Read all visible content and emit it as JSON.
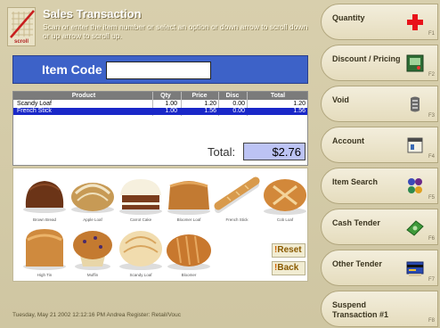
{
  "header": {
    "logo_label": "scroll",
    "title": "Sales Transaction",
    "instruction": "Scan or enter the item number or select an option or down arrow to scroll down or up arrow to scroll up."
  },
  "item_code": {
    "label": "Item Code",
    "value": ""
  },
  "table": {
    "columns": [
      "Product",
      "Qty",
      "Price",
      "Disc",
      "Total"
    ],
    "rows": [
      {
        "product": "Scandy Loaf",
        "qty": "1.00",
        "price": "1.20",
        "disc": "0.00",
        "total": "1.20"
      },
      {
        "product": "French Stick",
        "qty": "1.00",
        "price": "1.56",
        "disc": "0.00",
        "total": "1.56"
      }
    ]
  },
  "total": {
    "label": "Total:",
    "value": "$2.76"
  },
  "products": [
    {
      "name": "Brown Bread"
    },
    {
      "name": "Apple Loaf"
    },
    {
      "name": "Carrot Cake"
    },
    {
      "name": "Bloomer Loaf"
    },
    {
      "name": "French Stick"
    },
    {
      "name": "Cob Loaf"
    },
    {
      "name": "High Tin"
    },
    {
      "name": "Muffin"
    },
    {
      "name": "Scandy Loaf"
    },
    {
      "name": "Bloomer"
    }
  ],
  "grid_buttons": {
    "reset": "Reset",
    "back": "Back"
  },
  "status_bar": {
    "text": "Tuesday, May 21 2002   12:12:16 PM   Andrea   Register: Retail/Vouc"
  },
  "side_buttons": [
    {
      "label": "Quantity",
      "fkey": "F1",
      "icon": "red-plus-icon"
    },
    {
      "label": "Discount / Pricing",
      "fkey": "F2",
      "icon": "discount-icon"
    },
    {
      "label": "Void",
      "fkey": "F3",
      "icon": "void-icon"
    },
    {
      "label": "Account",
      "fkey": "F4",
      "icon": "account-icon"
    },
    {
      "label": "Item Search",
      "fkey": "F5",
      "icon": "search-icon"
    },
    {
      "label": "Cash Tender",
      "fkey": "F6",
      "icon": "cash-icon"
    },
    {
      "label": "Other Tender",
      "fkey": "F7",
      "icon": "card-icon"
    },
    {
      "label": "Suspend Transaction #1",
      "fkey": "F8",
      "icon": ""
    }
  ],
  "colors": {
    "background": "#d8cfad",
    "item_code_bar": "#3d62c8",
    "selected_row": "#1a28c8",
    "total_box": "#bcc3f4",
    "plus": "#e8121a"
  }
}
